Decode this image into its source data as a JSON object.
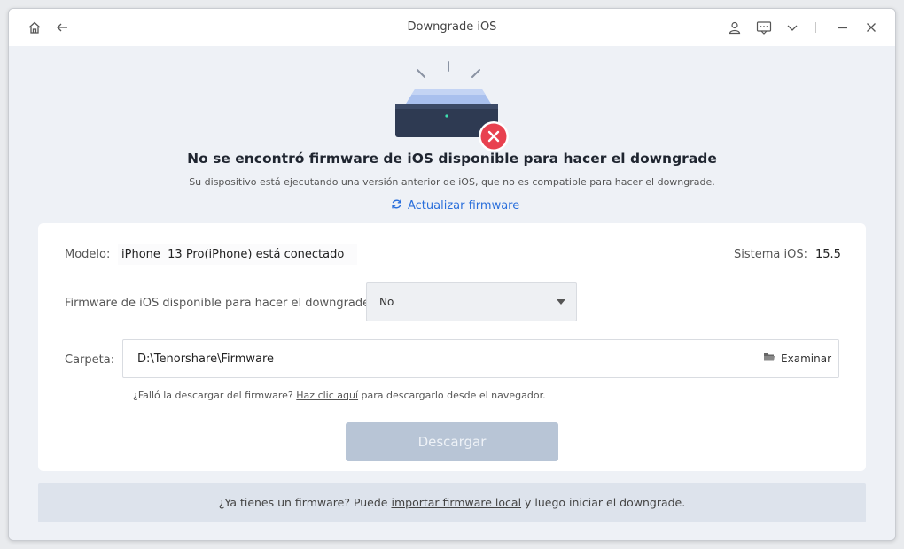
{
  "window": {
    "title": "Downgrade iOS"
  },
  "icons": {
    "home": "home-icon",
    "back": "arrow-left-icon",
    "user": "user-icon",
    "feedback": "message-icon",
    "menu": "chevron-down-icon",
    "minimize": "minimize-icon",
    "close": "close-icon"
  },
  "hero": {
    "title": "No se encontró firmware de iOS disponible para hacer el downgrade",
    "subtitle": "Su dispositivo está ejecutando una versión anterior de iOS, que no es compatible para hacer el downgrade.",
    "refresh_label": "Actualizar firmware"
  },
  "device": {
    "model_label": "Modelo:",
    "model_value": "iPhone  13 Pro(iPhone) está conectado",
    "ios_label": "Sistema iOS:",
    "ios_value": "15.5"
  },
  "firmware": {
    "label": "Firmware de iOS disponible para hacer el downgrade:",
    "selected": "No"
  },
  "folder": {
    "label": "Carpeta:",
    "path": "D:\\Tenorshare\\Firmware",
    "browse_label": "Examinar"
  },
  "hint": {
    "prefix": "¿Falló la descargar del firmware? ",
    "link": "Haz clic aquí",
    "suffix": " para descargarlo desde el navegador."
  },
  "download_button": "Descargar",
  "footer": {
    "prefix": "¿Ya tienes un firmware? Puede ",
    "link": "importar firmware local",
    "suffix": " y luego iniciar el downgrade."
  },
  "colors": {
    "accent": "#2a6fdb",
    "error": "#e8414f",
    "button_disabled": "#b8c5d6",
    "footer_bg": "#dde3ec"
  }
}
